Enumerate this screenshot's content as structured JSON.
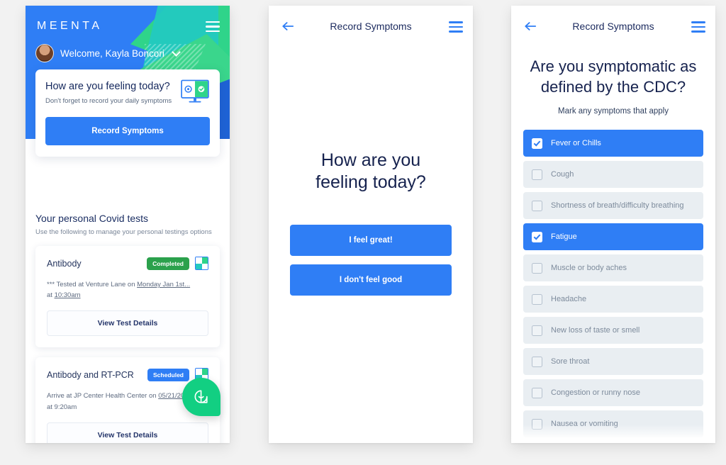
{
  "home": {
    "brand": "MEENTA",
    "welcome": "Welcome, Kayla Boncori",
    "feel_card": {
      "title": "How are you feeling today?",
      "subtitle": "Don't forget to record your daily symptoms",
      "cta": "Record Symptoms"
    },
    "section": {
      "title": "Your personal Covid tests",
      "subtitle": "Use the following to manage your personal testings options"
    },
    "tests": [
      {
        "name": "Antibody",
        "status": "Completed",
        "status_type": "completed",
        "meta_line1_pre": "*** Tested at Venture Lane on ",
        "meta_line1_link": "Monday Jan 1st...",
        "meta_line2_pre": "at ",
        "meta_line2_link": "10:30am",
        "action": "View Test Details"
      },
      {
        "name": "Antibody and RT-PCR",
        "status": "Scheduled",
        "status_type": "scheduled",
        "meta_line1_pre": "Arrive at JP Center Health Center on ",
        "meta_line1_link": "05/21/2020",
        "meta_line2_pre": "at 9:20am",
        "meta_line2_link": "",
        "action": "View Test Details"
      }
    ]
  },
  "feeling": {
    "topbar_title": "Record Symptoms",
    "question_line1": "How are you",
    "question_line2": "feeling today?",
    "buttons": [
      {
        "label": "I feel great!"
      },
      {
        "label": "I don't feel good"
      }
    ]
  },
  "symptoms": {
    "topbar_title": "Record Symptoms",
    "question_line1": "Are you symptomatic as",
    "question_line2": "defined by the CDC?",
    "subtitle": "Mark any symptoms that apply",
    "items": [
      {
        "label": "Fever or Chills",
        "checked": true
      },
      {
        "label": "Cough",
        "checked": false
      },
      {
        "label": "Shortness of breath/difficulty breathing",
        "checked": false
      },
      {
        "label": "Fatigue",
        "checked": true
      },
      {
        "label": "Muscle or body aches",
        "checked": false
      },
      {
        "label": "Headache",
        "checked": false
      },
      {
        "label": "New loss of taste or smell",
        "checked": false
      },
      {
        "label": "Sore throat",
        "checked": false
      },
      {
        "label": "Congestion or runny nose",
        "checked": false
      },
      {
        "label": "Nausea or vomiting",
        "checked": false
      }
    ]
  },
  "colors": {
    "primary_blue": "#2f7ef5",
    "dark_blue": "#1f63d6",
    "green": "#2ba14c",
    "accent_green": "#2fd48a",
    "teal": "#23c9c0",
    "chat_green": "#12cf82",
    "page_bg": "#f2f2f2",
    "row_bg": "#e9eef2"
  }
}
